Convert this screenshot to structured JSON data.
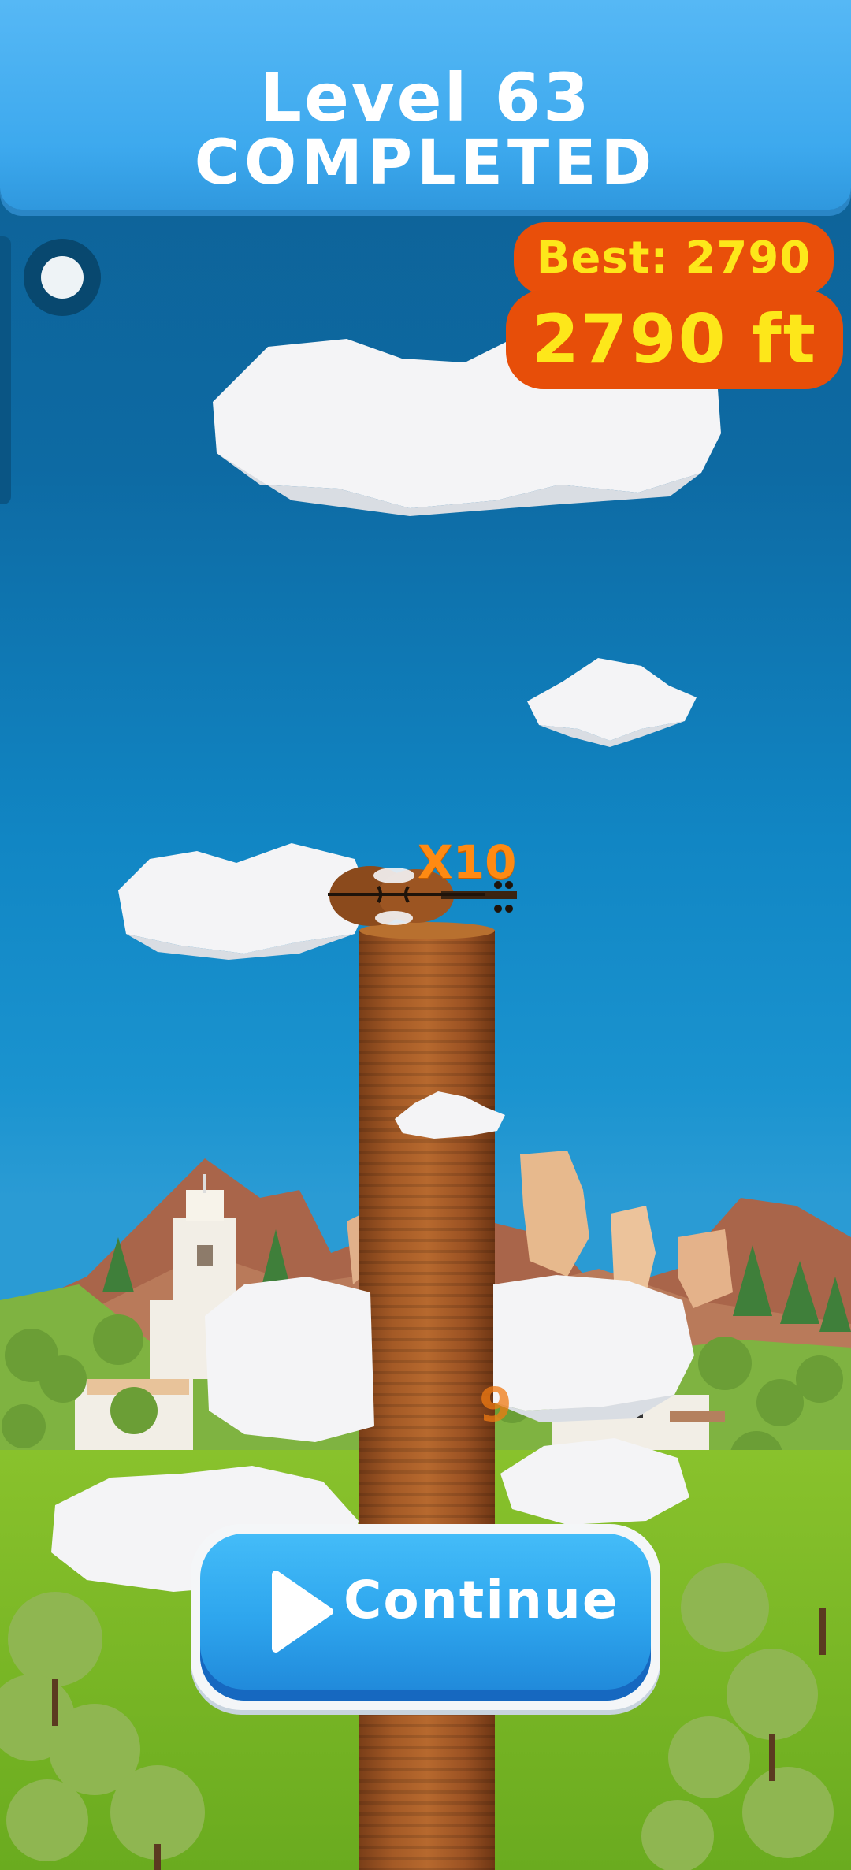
{
  "header": {
    "line1": "Level 63",
    "line2": "COMPLETED"
  },
  "score": {
    "best": "Best: 2790",
    "height": "2790 ft"
  },
  "multiplier": "X10",
  "ghost_multiplier": "9",
  "continue": {
    "label": "Continue",
    "icon": "play-icon"
  },
  "colors": {
    "banner": "#3da9ee",
    "score_bg": "#e74e09",
    "score_text": "#fde71a",
    "button": "#2ea6ee",
    "multiplier": "#ff8a12"
  }
}
